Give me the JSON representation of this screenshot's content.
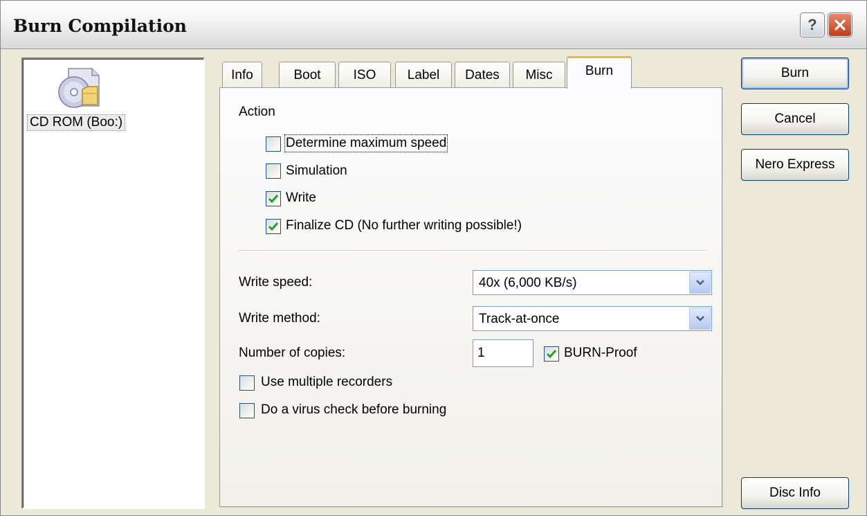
{
  "window": {
    "title": "Burn Compilation"
  },
  "left_panel": {
    "item_label": "CD ROM (Boo:)",
    "item_icon": "cd-folder-icon"
  },
  "tabs": [
    {
      "label": "Info"
    },
    {
      "label": "Boot"
    },
    {
      "label": "ISO"
    },
    {
      "label": "Label"
    },
    {
      "label": "Dates"
    },
    {
      "label": "Misc"
    },
    {
      "label": "Burn",
      "active": true
    }
  ],
  "burn_tab": {
    "action_heading": "Action",
    "determine_max_speed": {
      "label": "Determine maximum speed",
      "checked": false
    },
    "simulation": {
      "label": "Simulation",
      "checked": false
    },
    "write": {
      "label": "Write",
      "checked": true
    },
    "finalize_cd": {
      "label": "Finalize CD (No further writing possible!)",
      "checked": true
    },
    "write_speed": {
      "label": "Write speed:",
      "value": "40x (6,000 KB/s)"
    },
    "write_method": {
      "label": "Write method:",
      "value": "Track-at-once"
    },
    "number_of_copies": {
      "label": "Number of copies:",
      "value": "1"
    },
    "burn_proof": {
      "label": "BURN-Proof",
      "checked": true
    },
    "use_multiple_recorders": {
      "label": "Use multiple recorders",
      "checked": false
    },
    "virus_check": {
      "label": "Do a virus check before burning",
      "checked": false
    }
  },
  "buttons": {
    "burn": "Burn",
    "cancel": "Cancel",
    "nero_express": "Nero Express",
    "disc_info": "Disc Info"
  },
  "colors": {
    "dialog_bg": "#ece9d8",
    "active_tab_accent": "#f7b33f",
    "checkmark": "#21a121",
    "close_button": "#c4391a"
  }
}
